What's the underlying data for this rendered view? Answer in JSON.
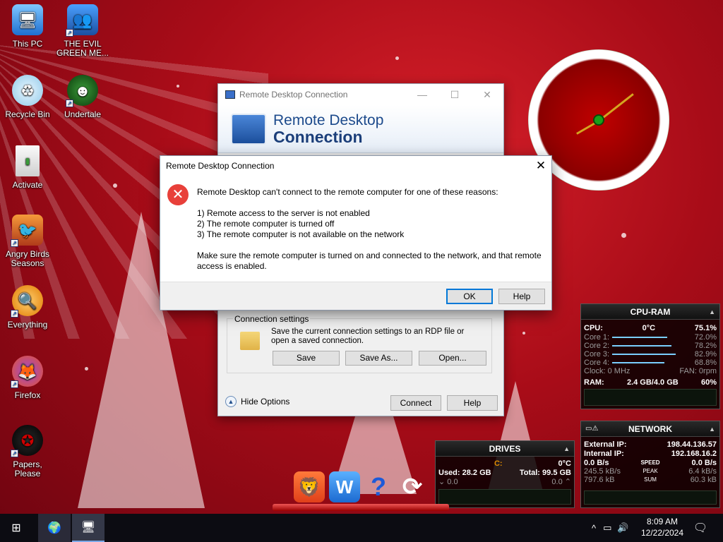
{
  "desktop": {
    "icons": [
      {
        "label": "This PC"
      },
      {
        "label": "THE EVIL GREEN ME..."
      },
      {
        "label": "Recycle Bin"
      },
      {
        "label": "Undertale"
      },
      {
        "label": "Activate"
      },
      {
        "label": "Angry Birds Seasons"
      },
      {
        "label": "Everything"
      },
      {
        "label": "Firefox"
      },
      {
        "label": "Papers, Please"
      }
    ]
  },
  "rdc_window": {
    "title": "Remote Desktop Connection",
    "banner_line1": "Remote Desktop",
    "banner_line2": "Connection",
    "connection_settings": {
      "legend": "Connection settings",
      "description": "Save the current connection settings to an RDP file or open a saved connection.",
      "save": "Save",
      "save_as": "Save As...",
      "open": "Open..."
    },
    "hide_options": "Hide Options",
    "connect": "Connect",
    "help": "Help"
  },
  "error_dialog": {
    "title": "Remote Desktop Connection",
    "intro": "Remote Desktop can't connect to the remote computer for one of these reasons:",
    "reasons": [
      "1) Remote access to the server is not enabled",
      "2) The remote computer is turned off",
      "3) The remote computer is not available on the network"
    ],
    "advice": "Make sure the remote computer is turned on and connected to the network, and that remote access is enabled.",
    "ok": "OK",
    "help": "Help"
  },
  "cpu_ram": {
    "title": "CPU-RAM",
    "cpu_label": "CPU:",
    "cpu_temp": "0°C",
    "cpu_total": "75.1%",
    "cores": [
      {
        "label": "Core 1:",
        "value": "72.0%",
        "level": 0.72
      },
      {
        "label": "Core 2:",
        "value": "78.2%",
        "level": 0.782
      },
      {
        "label": "Core 3:",
        "value": "82.9%",
        "level": 0.829
      },
      {
        "label": "Core 4:",
        "value": "68.8%",
        "level": 0.688
      }
    ],
    "clock": "Clock: 0 MHz",
    "fan": "FAN: 0rpm",
    "ram_label": "RAM:",
    "ram_usage": "2.4 GB/4.0 GB",
    "ram_percent": "60%"
  },
  "network": {
    "title": "NETWORK",
    "external_label": "External IP:",
    "external_ip": "198.44.136.57",
    "internal_label": "Internal IP:",
    "internal_ip": "192.168.16.2",
    "rows": [
      {
        "left": "0.0 B/s",
        "mid": "SPEED",
        "right": "0.0 B/s"
      },
      {
        "left": "245.5 kB/s",
        "mid": "PEAK",
        "right": "6.4 kB/s"
      },
      {
        "left": "797.6 kB",
        "mid": "SUM",
        "right": "60.3 kB"
      }
    ]
  },
  "drives": {
    "title": "DRIVES",
    "drive": "C:",
    "temp": "0°C",
    "used": "Used: 28.2 GB",
    "total": "Total: 99.5 GB",
    "read": "0.0",
    "write": "0.0"
  },
  "taskbar": {
    "time": "8:09 AM",
    "date": "12/22/2024"
  },
  "colors": {
    "accent": "#0078d7",
    "error": "#e8403a",
    "wallpaper": "#b0101c"
  }
}
